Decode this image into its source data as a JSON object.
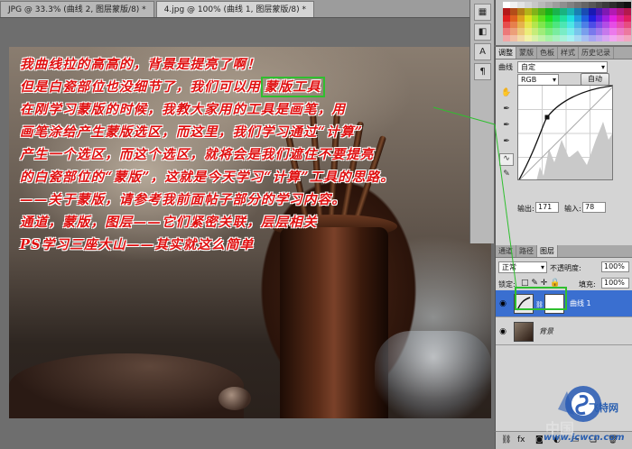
{
  "tabs": [
    {
      "label": "JPG @ 33.3% (曲线 2, 图层蒙版/8) *",
      "active": false
    },
    {
      "label": "4.jpg @ 100% (曲线 1, 图层蒙版/8) *",
      "active": true
    }
  ],
  "canvas_text": {
    "line1": "我曲线拉的高高的，背景是提亮了啊！",
    "line2_before": "但是白瓷部位也没细节了，我们可以用",
    "line2_highlight": "蒙版工具",
    "line3": "在刚学习蒙版的时候，我教大家用的工具是画笔，用",
    "line4": "画笔涂给产生蒙版选区，而这里，我们学习通过“计算”",
    "line5": "产生一个选区，而这个选区，就将会是我们遮住不要提亮",
    "line6": "的白瓷部位的“蒙版”，这就是今天学习“计算”工具的思路。",
    "line7": "——关于蒙版，请参考我前面帖子部分的学习内容。",
    "line8": "通道，蒙版，图层——它们紧密关联，层层相关",
    "line9": "PS学习三座大山——其实就这么简单"
  },
  "adjust_panel": {
    "tabs": [
      "调整",
      "蒙版",
      "色板",
      "样式",
      "历史记录"
    ],
    "mode_label": "曲线",
    "preset_label": "自定",
    "channel": "RGB",
    "auto_button": "自动",
    "output_label": "输出:",
    "output_value": "171",
    "input_label": "输入:",
    "input_value": "78"
  },
  "layers_panel": {
    "tabs": [
      "通道",
      "路径",
      "图层"
    ],
    "blend_mode": "正常",
    "opacity_label": "不透明度:",
    "opacity_value": "100%",
    "lock_label": "锁定:",
    "fill_label": "填充:",
    "fill_value": "100%",
    "layers": [
      {
        "name": "曲线 1",
        "selected": true
      },
      {
        "name": "背景",
        "selected": false
      }
    ]
  },
  "watermark": {
    "site": "www.jcwcn.com",
    "zh": "中国",
    "logo_text": "飞特网"
  },
  "colors": {
    "annotation_red": "#e01010",
    "highlight_green": "#2fbf2f",
    "selected_layer": "#3a6fd0"
  },
  "icons": [
    "eye-icon",
    "chain-link-icon",
    "lock-icon",
    "eyedropper-icon",
    "hand-icon",
    "pencil-icon",
    "curve-icon",
    "trash-icon",
    "new-layer-icon",
    "mask-icon",
    "fx-icon"
  ]
}
